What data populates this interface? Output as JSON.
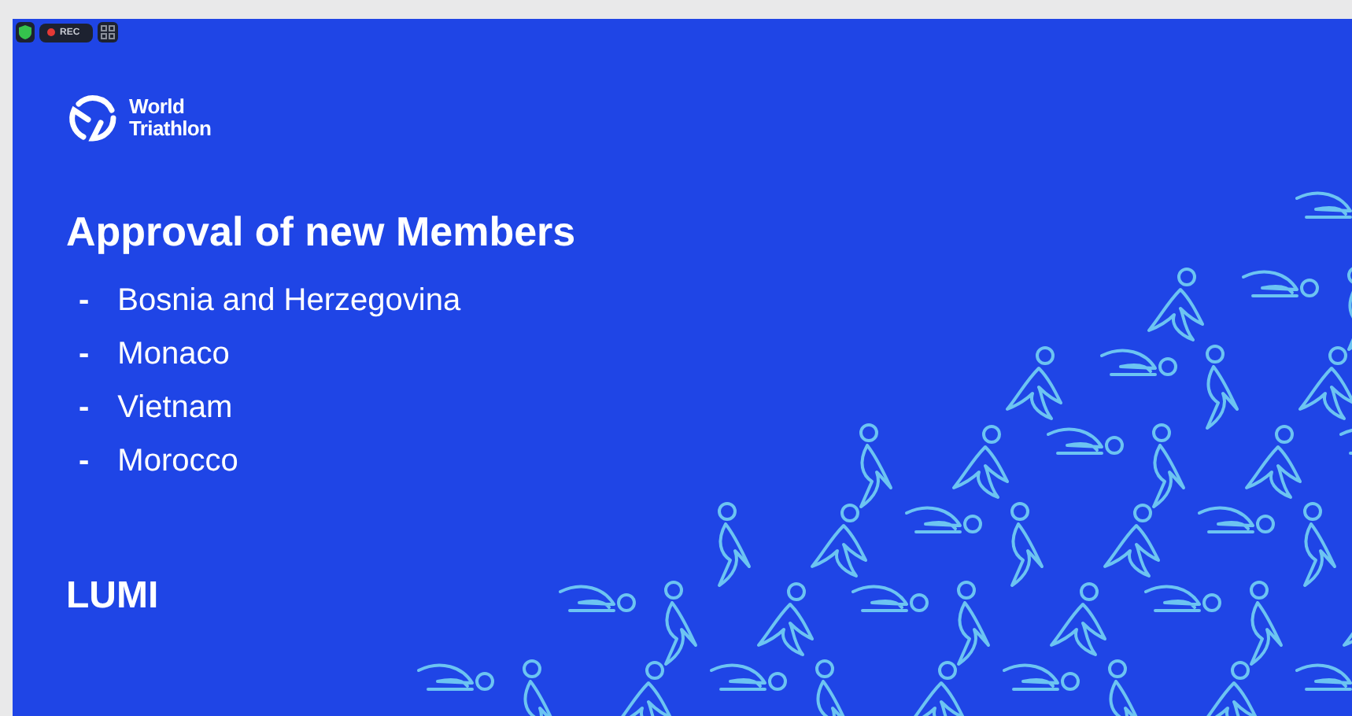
{
  "recording_indicator": {
    "label": "REC"
  },
  "slide": {
    "logo": {
      "line_1": "World",
      "line_2": "Triathlon"
    },
    "title": "Approval of new Members",
    "items": [
      {
        "bullet": "-",
        "text": "Bosnia and Herzegovina"
      },
      {
        "bullet": "-",
        "text": "Monaco"
      },
      {
        "bullet": "-",
        "text": "Vietnam"
      },
      {
        "bullet": "-",
        "text": "Morocco"
      }
    ],
    "footer": "LUMI"
  }
}
